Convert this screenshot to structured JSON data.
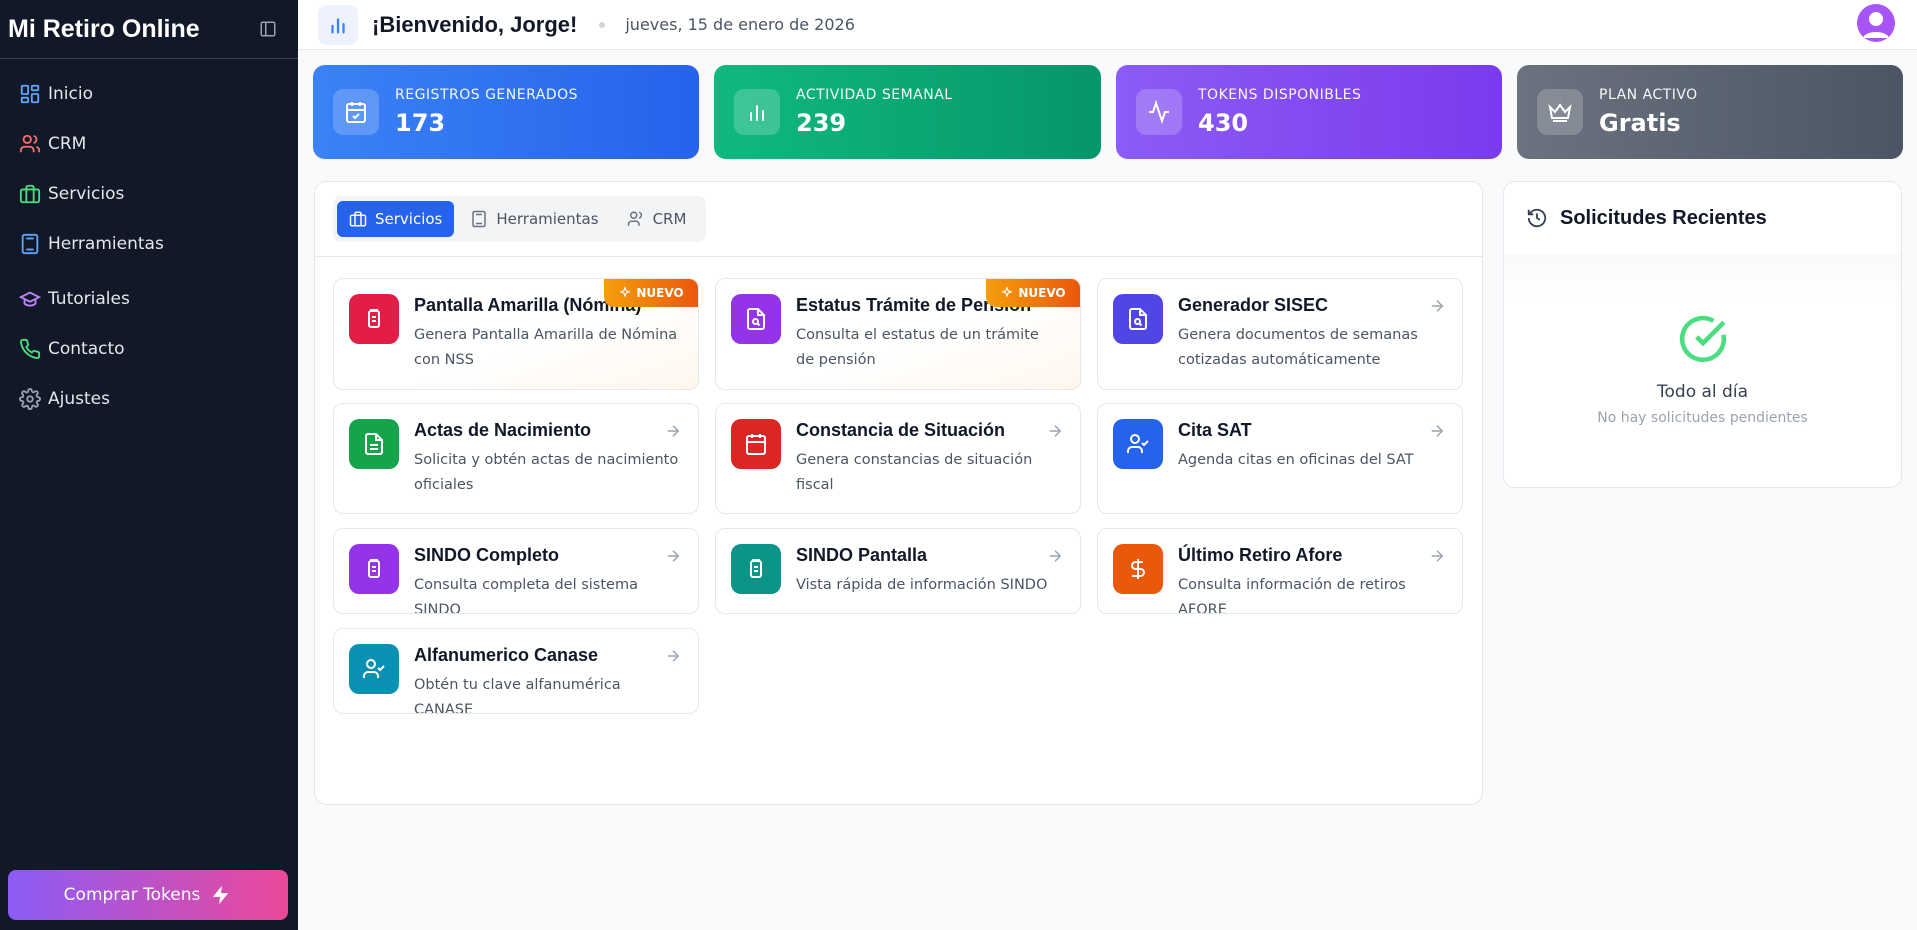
{
  "app": {
    "title": "Mi Retiro Online"
  },
  "sidebar": {
    "items": [
      {
        "label": "Inicio",
        "icon": "layout-grid-icon",
        "color": "#60a5fa"
      },
      {
        "label": "CRM",
        "icon": "users-icon",
        "color": "#f87171"
      },
      {
        "label": "Servicios",
        "icon": "briefcase-icon",
        "color": "#4ade80"
      },
      {
        "label": "Herramientas",
        "icon": "calculator-icon",
        "color": "#60a5fa"
      },
      {
        "label": "Tutoriales",
        "icon": "graduation-cap-icon",
        "color": "#c084fc"
      },
      {
        "label": "Contacto",
        "icon": "phone-icon",
        "color": "#4ade80"
      },
      {
        "label": "Ajustes",
        "icon": "gear-icon",
        "color": "#9ca3af"
      }
    ],
    "buy_label": "Comprar Tokens"
  },
  "header": {
    "welcome": "¡Bienvenido, Jorge!",
    "date": "jueves, 15 de enero de 2026"
  },
  "stats": [
    {
      "label": "REGISTROS GENERADOS",
      "value": "173",
      "color": "#3b82f6"
    },
    {
      "label": "ACTIVIDAD SEMANAL",
      "value": "239",
      "color": "#10b981"
    },
    {
      "label": "TOKENS DISPONIBLES",
      "value": "430",
      "color": "#8b5cf6"
    },
    {
      "label": "PLAN ACTIVO",
      "value": "Gratis",
      "color": "#6b7280"
    }
  ],
  "tabs": [
    {
      "label": "Servicios",
      "active": true
    },
    {
      "label": "Herramientas",
      "active": false
    },
    {
      "label": "CRM",
      "active": false
    }
  ],
  "badge_label": "NUEVO",
  "services": [
    {
      "title": "Pantalla Amarilla (Nómina)",
      "desc": "Genera Pantalla Amarilla de Nómina con NSS",
      "color": "#e11d48",
      "icon": "clipboard-icon",
      "new": true
    },
    {
      "title": "Estatus Trámite de Pensión",
      "desc": "Consulta el estatus de un trámite de pensión",
      "color": "#9333ea",
      "icon": "file-search-icon",
      "new": true
    },
    {
      "title": "Generador SISEC",
      "desc": "Genera documentos de semanas cotizadas automáticamente",
      "color": "#4f46e5",
      "icon": "file-search-icon",
      "new": false
    },
    {
      "title": "Actas de Nacimiento",
      "desc": "Solicita y obtén actas de nacimiento oficiales",
      "color": "#16a34a",
      "icon": "file-text-icon",
      "new": false
    },
    {
      "title": "Constancia de Situación",
      "desc": "Genera constancias de situación fiscal",
      "color": "#dc2626",
      "icon": "calendar-icon",
      "new": false
    },
    {
      "title": "Cita SAT",
      "desc": "Agenda citas en oficinas del SAT",
      "color": "#2563eb",
      "icon": "user-check-icon",
      "new": false
    },
    {
      "title": "SINDO Completo",
      "desc": "Consulta completa del sistema SINDO",
      "color": "#9333ea",
      "icon": "clipboard-icon",
      "new": false
    },
    {
      "title": "SINDO Pantalla",
      "desc": "Vista rápida de información SINDO",
      "color": "#0d9488",
      "icon": "clipboard-icon",
      "new": false
    },
    {
      "title": "Último Retiro Afore",
      "desc": "Consulta información de retiros AFORE",
      "color": "#ea580c",
      "icon": "dollar-icon",
      "new": false
    },
    {
      "title": "Alfanumerico Canase",
      "desc": "Obtén tu clave alfanumérica CANASE",
      "color": "#0891b2",
      "icon": "user-check-icon",
      "new": false
    }
  ],
  "recent": {
    "title": "Solicitudes Recientes",
    "empty_title": "Todo al día",
    "empty_sub": "No hay solicitudes pendientes"
  }
}
